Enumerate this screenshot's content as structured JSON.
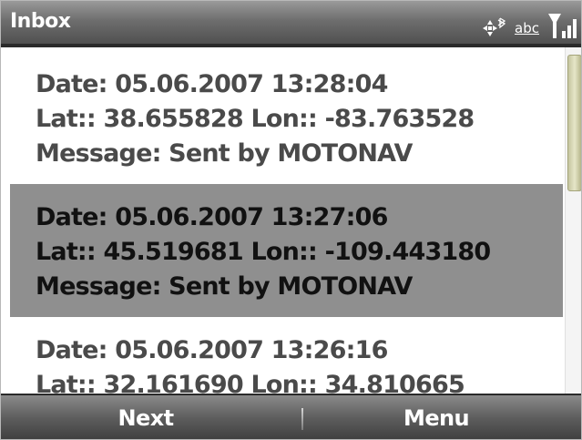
{
  "header": {
    "title": "Inbox",
    "status": {
      "input_mode": "abc",
      "icons": [
        "navigation-icon",
        "bluetooth-icon",
        "signal-icon"
      ]
    }
  },
  "messages": [
    {
      "date": "Date: 05.06.2007 13:28:04",
      "coords": "Lat:: 38.655828 Lon:: -83.763528",
      "message": "Message: Sent by MOTONAV",
      "selected": false
    },
    {
      "date": "Date: 05.06.2007 13:27:06",
      "coords": "Lat:: 45.519681 Lon:: -109.443180",
      "message": "Message: Sent by MOTONAV",
      "selected": true
    },
    {
      "date": "Date: 05.06.2007 13:26:16",
      "coords": "Lat:: 32.161690 Lon:: 34.810665",
      "message": "",
      "selected": false
    }
  ],
  "softkeys": {
    "left": "Next",
    "right": "Menu"
  },
  "colors": {
    "selection": "#8f8f8f",
    "bar_dark": "#3e3e3e",
    "text": "#4a4a4a"
  }
}
